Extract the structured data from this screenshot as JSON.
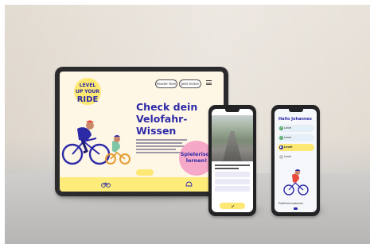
{
  "tablet": {
    "logo": [
      "LEVEL",
      "UP YOUR",
      "RIDE"
    ],
    "nav_buttons": [
      "Header Item",
      "Jetzt testen"
    ],
    "menu_icon": "hamburger-icon",
    "headline": "Check dein\nVelofahr-\nWissen",
    "badge": "Spielerisch\nlernen!",
    "bottom_icons": [
      "bike-icon",
      "helmet-icon"
    ],
    "colors": {
      "ink": "#2d2aa8",
      "accent": "#fde873",
      "badge": "#f5a8c8"
    }
  },
  "phone_quiz": {
    "continue_icon": "check-icon"
  },
  "phone_levels": {
    "title": "Hallo Johannes",
    "levels": [
      {
        "label": "Level",
        "state": "done"
      },
      {
        "label": "Level",
        "state": "done"
      },
      {
        "label": "Level",
        "state": "current"
      },
      {
        "label": "Level",
        "state": "locked"
      }
    ],
    "footer": "Profilinformationen"
  }
}
